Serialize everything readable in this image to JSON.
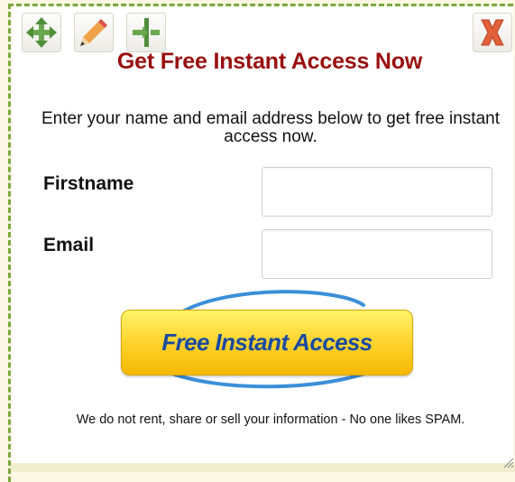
{
  "toolbar": {
    "move_icon": "move-icon",
    "edit_icon": "pencil-icon",
    "resize_icon": "split-width-icon",
    "close_icon": "close-icon"
  },
  "form": {
    "title": "Get Free Instant Access Now",
    "intro": "Enter your name and email address below to get free instant access now.",
    "firstname_label": "Firstname",
    "firstname_value": "",
    "email_label": "Email",
    "email_value": "",
    "submit_label": "Free Instant Access",
    "disclaimer": "We do not rent, share or sell your information - No one likes SPAM."
  },
  "colors": {
    "title": "#9a0f0f",
    "button_top": "#fff36a",
    "button_bottom": "#f6b800",
    "button_text": "#1a4ba0",
    "frame_dash": "#7aa83a"
  }
}
